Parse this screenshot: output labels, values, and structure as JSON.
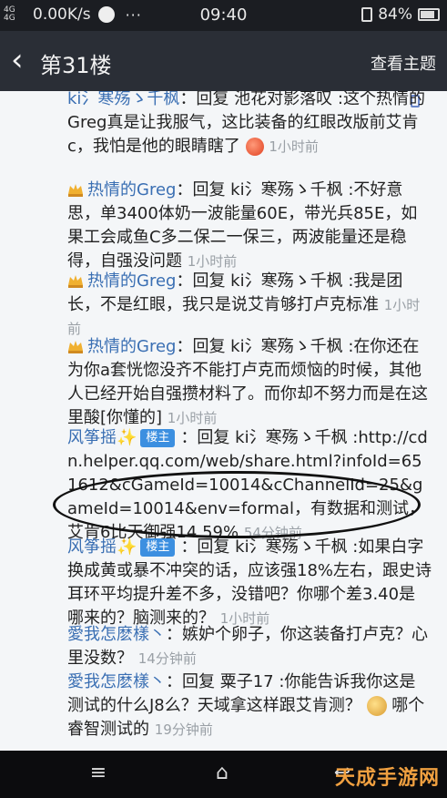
{
  "status_bar": {
    "network": "4G 4G",
    "speed": "0.00K/s",
    "time": "09:40",
    "battery": "84%"
  },
  "header": {
    "title": "第31楼",
    "topic_button": "查看主题"
  },
  "posts": [
    {
      "user": "ki氵寒殇ゝ千枫",
      "text": "：回复 池花对影落叹 :这个热情的Greg真是让我服气，这比装备的红眼改版前艾肯c，我怕是他的眼睛瞎了",
      "time": "1小时前"
    },
    {
      "user": "热情的Greg",
      "text": "：回复 ki氵寒殇ゝ千枫 :不好意思，单3400体奶一波能量60E，带光兵85E，如果工会咸鱼C多二保二一保三，两波能量还是稳得，自强没问题",
      "time": "1小时前"
    },
    {
      "user": "热情的Greg",
      "text": "：回复 ki氵寒殇ゝ千枫 :我是团长，不是红眼，我只是说艾肯够打卢克标准",
      "time": "1小时前"
    },
    {
      "user": "热情的Greg",
      "text": "：回复 ki氵寒殇ゝ千枫 :在你还在为你a套恍惚没齐不能打卢克而烦恼的时候，其他人已经开始自强攒材料了。而你却不努力而是在这里酸[你懂的]",
      "time": "1小时前"
    },
    {
      "user": "风筝摇✨",
      "badge": "楼主",
      "text": "：回复 ki氵寒殇ゝ千枫 :http://cdn.helper.qq.com/web/share.html?infoId=651612&cGameId=10014&cChannelId=25&gameId=10014&env=formal，有数据和测试，艾肯6比天御强14.59%",
      "time": "54分钟前"
    },
    {
      "user": "风筝摇✨",
      "badge": "楼主",
      "text": "：回复 ki氵寒殇ゝ千枫 :如果白字换成黄或暴不冲突的话，应该强18%左右，跟史诗耳环平均提升差不多，没错吧？你哪个差3.40是哪来的？脑测来的？",
      "time": "1小时前"
    },
    {
      "user": "愛我怎麽樣丶",
      "text": "：嫉妒个卵子，你这装备打卢克？心里没数？",
      "time": "14分钟前"
    },
    {
      "user": "愛我怎麽樣丶",
      "text": "：回复 粟子17 :你能告诉我你这是测试的什么J8么？天域拿这样跟艾肯测？",
      "tail": "哪个睿智测试的",
      "time": "19分钟前"
    }
  ],
  "watermark": "天成手游网"
}
